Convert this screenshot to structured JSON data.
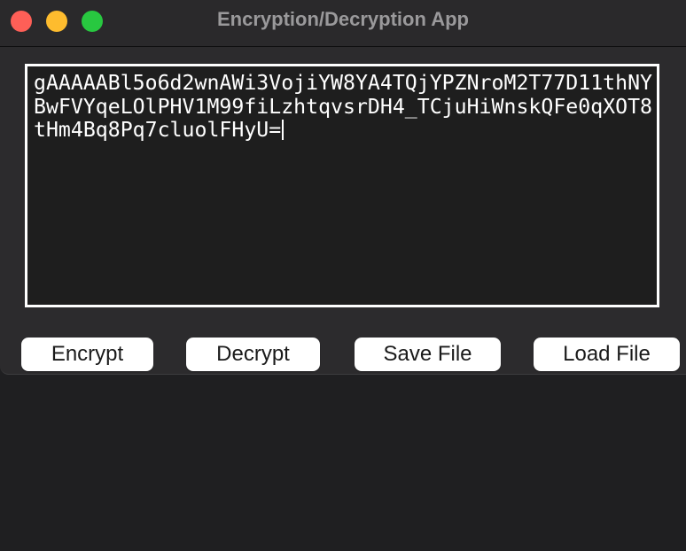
{
  "window": {
    "title": "Encryption/Decryption App"
  },
  "traffic_lights": [
    {
      "name": "close",
      "color": "#fe5f57"
    },
    {
      "name": "minimize",
      "color": "#febc2e"
    },
    {
      "name": "maximize",
      "color": "#28c840"
    }
  ],
  "editor": {
    "text": "gAAAAABl5o6d2wnAWi3VojiYW8YA4TQjYPZNroM2T77D11thNYBwFVYqeLOlPHV1M99fiLzhtqvsrDH4_TCjuHiWnskQFe0qXOT8tHm4Bq8Pq7cluolFHyU="
  },
  "buttons": {
    "encrypt": "Encrypt",
    "decrypt": "Decrypt",
    "save": "Save File",
    "load": "Load File"
  }
}
